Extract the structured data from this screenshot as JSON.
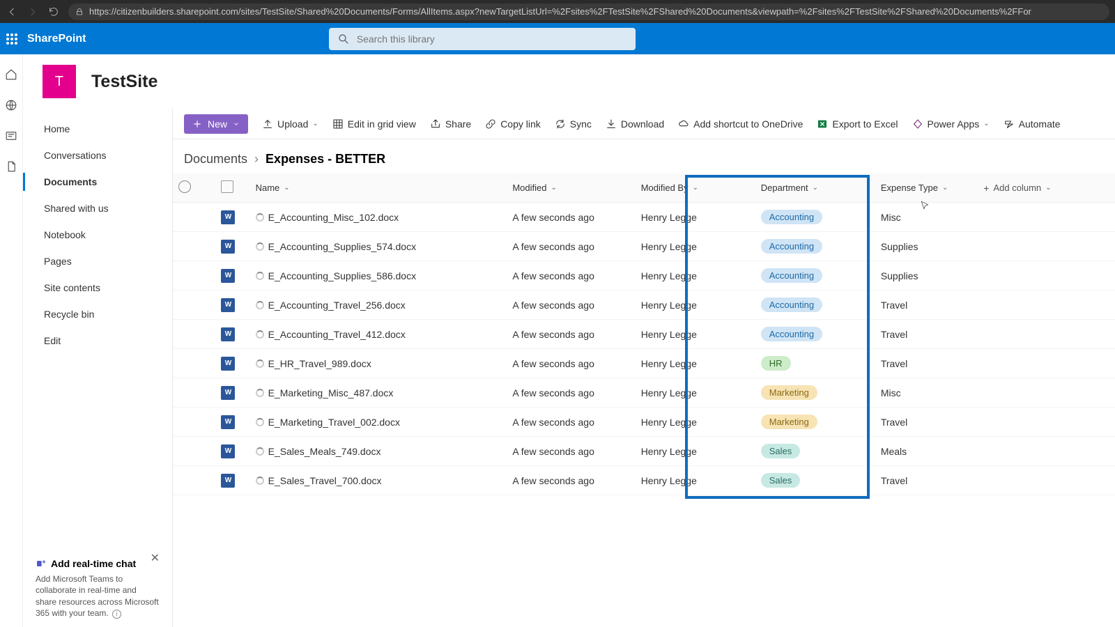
{
  "browser": {
    "url": "https://citizenbuilders.sharepoint.com/sites/TestSite/Shared%20Documents/Forms/AllItems.aspx?newTargetListUrl=%2Fsites%2FTestSite%2FShared%20Documents&viewpath=%2Fsites%2FTestSite%2FShared%20Documents%2FFor"
  },
  "suite": {
    "brand": "SharePoint",
    "search_placeholder": "Search this library"
  },
  "site": {
    "logo_letter": "T",
    "name": "TestSite"
  },
  "nav": {
    "items": [
      "Home",
      "Conversations",
      "Documents",
      "Shared with us",
      "Notebook",
      "Pages",
      "Site contents",
      "Recycle bin",
      "Edit"
    ],
    "active_index": 2
  },
  "chat": {
    "title": "Add real-time chat",
    "desc": "Add Microsoft Teams to collaborate in real-time and share resources across Microsoft 365 with your team."
  },
  "cmd": {
    "new": "New",
    "upload": "Upload",
    "edit_grid": "Edit in grid view",
    "share": "Share",
    "copy_link": "Copy link",
    "sync": "Sync",
    "download": "Download",
    "shortcut": "Add shortcut to OneDrive",
    "export": "Export to Excel",
    "power_apps": "Power Apps",
    "automate": "Automate"
  },
  "breadcrumb": {
    "root": "Documents",
    "current": "Expenses - BETTER"
  },
  "columns": {
    "name": "Name",
    "modified": "Modified",
    "modified_by": "Modified By",
    "department": "Department",
    "expense_type": "Expense Type",
    "add_column": "Add column"
  },
  "rows": [
    {
      "name": "E_Accounting_Misc_102.docx",
      "modified": "A few seconds ago",
      "modified_by": "Henry Legge",
      "department": "Accounting",
      "expense_type": "Misc"
    },
    {
      "name": "E_Accounting_Supplies_574.docx",
      "modified": "A few seconds ago",
      "modified_by": "Henry Legge",
      "department": "Accounting",
      "expense_type": "Supplies"
    },
    {
      "name": "E_Accounting_Supplies_586.docx",
      "modified": "A few seconds ago",
      "modified_by": "Henry Legge",
      "department": "Accounting",
      "expense_type": "Supplies"
    },
    {
      "name": "E_Accounting_Travel_256.docx",
      "modified": "A few seconds ago",
      "modified_by": "Henry Legge",
      "department": "Accounting",
      "expense_type": "Travel"
    },
    {
      "name": "E_Accounting_Travel_412.docx",
      "modified": "A few seconds ago",
      "modified_by": "Henry Legge",
      "department": "Accounting",
      "expense_type": "Travel"
    },
    {
      "name": "E_HR_Travel_989.docx",
      "modified": "A few seconds ago",
      "modified_by": "Henry Legge",
      "department": "HR",
      "expense_type": "Travel"
    },
    {
      "name": "E_Marketing_Misc_487.docx",
      "modified": "A few seconds ago",
      "modified_by": "Henry Legge",
      "department": "Marketing",
      "expense_type": "Misc"
    },
    {
      "name": "E_Marketing_Travel_002.docx",
      "modified": "A few seconds ago",
      "modified_by": "Henry Legge",
      "department": "Marketing",
      "expense_type": "Travel"
    },
    {
      "name": "E_Sales_Meals_749.docx",
      "modified": "A few seconds ago",
      "modified_by": "Henry Legge",
      "department": "Sales",
      "expense_type": "Meals"
    },
    {
      "name": "E_Sales_Travel_700.docx",
      "modified": "A few seconds ago",
      "modified_by": "Henry Legge",
      "department": "Sales",
      "expense_type": "Travel"
    }
  ]
}
